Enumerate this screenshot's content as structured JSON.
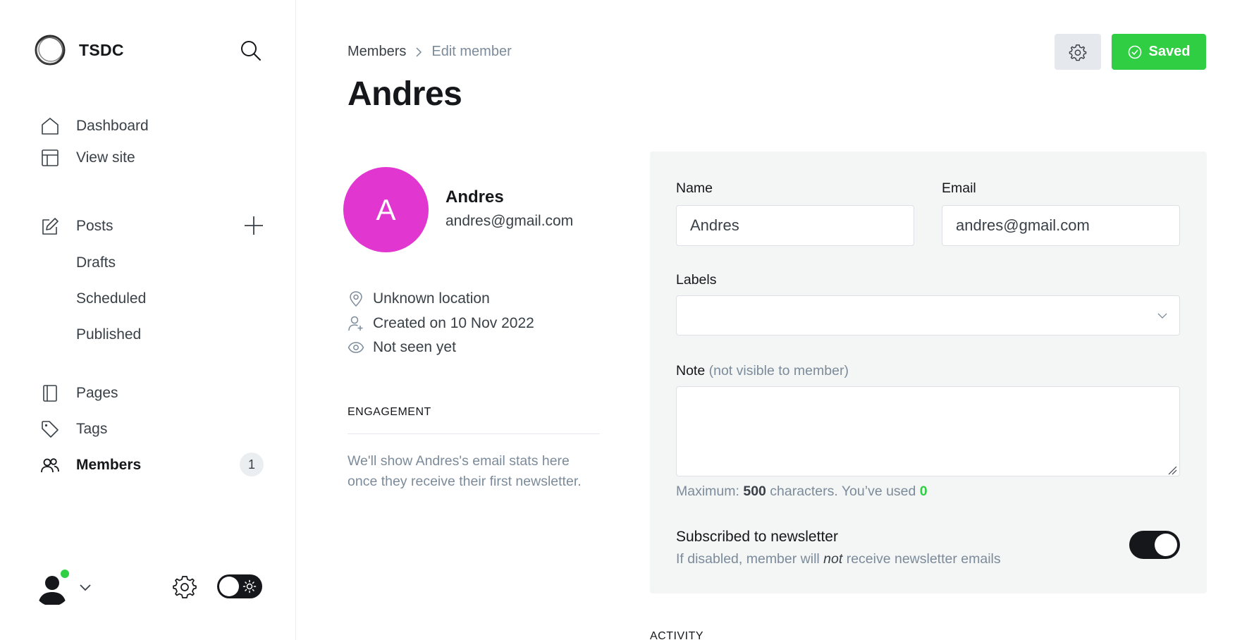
{
  "sidebar": {
    "brand": "TSDC",
    "nav": [
      {
        "label": "Dashboard",
        "icon": "home-icon"
      },
      {
        "label": "View site",
        "icon": "layout-icon"
      }
    ],
    "posts": {
      "label": "Posts",
      "icon": "pencil-square-icon",
      "sub": [
        "Drafts",
        "Scheduled",
        "Published"
      ]
    },
    "nav2": [
      {
        "label": "Pages",
        "icon": "page-icon"
      },
      {
        "label": "Tags",
        "icon": "tag-icon"
      },
      {
        "label": "Members",
        "icon": "members-icon",
        "badge": "1"
      }
    ]
  },
  "header": {
    "breadcrumb_parent": "Members",
    "breadcrumb_current": "Edit member",
    "title": "Andres",
    "saved_label": "Saved"
  },
  "member": {
    "initial": "A",
    "name": "Andres",
    "email": "andres@gmail.com",
    "avatar_color": "#e236d0",
    "location": "Unknown location",
    "created": "Created on 10 Nov 2022",
    "seen": "Not seen yet"
  },
  "engagement": {
    "heading": "ENGAGEMENT",
    "text": "We'll show Andres's email stats here once they receive their first newsletter."
  },
  "form": {
    "name_label": "Name",
    "name_value": "Andres",
    "email_label": "Email",
    "email_value": "andres@gmail.com",
    "labels_label": "Labels",
    "note_label": "Note",
    "note_hint": "(not visible to member)",
    "counter_prefix": "Maximum: ",
    "counter_max": "500",
    "counter_mid": " characters. You’ve used ",
    "counter_used": "0",
    "sub_title": "Subscribed to newsletter",
    "sub_desc_1": "If disabled, member will ",
    "sub_desc_em": "not",
    "sub_desc_2": " receive newsletter emails",
    "subscribed": true
  },
  "activity": {
    "heading": "ACTIVITY"
  },
  "colors": {
    "accent_green": "#30cf43",
    "dark": "#15171a"
  }
}
